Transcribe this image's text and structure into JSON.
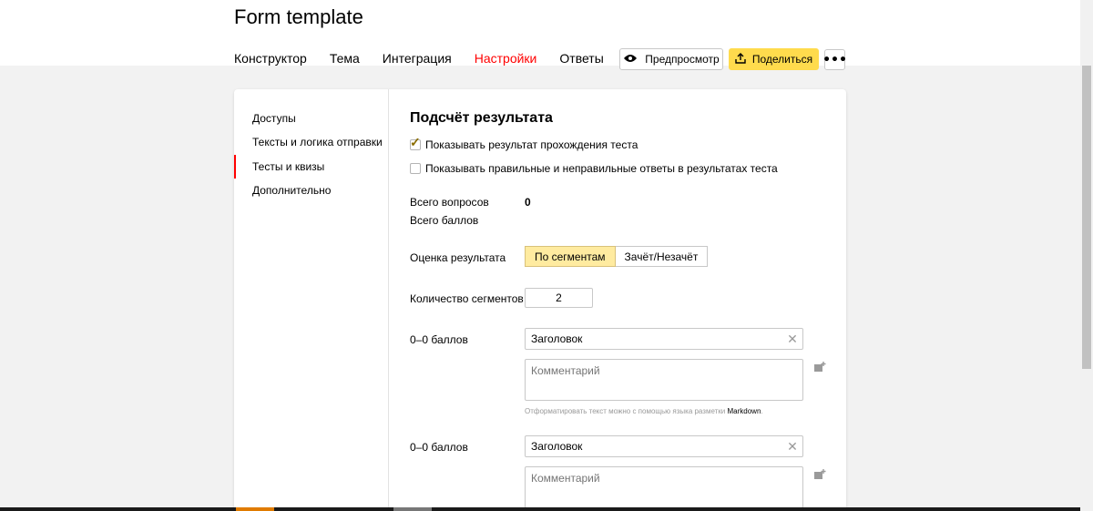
{
  "header": {
    "form_title": "Form template",
    "tabs": [
      {
        "label": "Конструктор",
        "active": false
      },
      {
        "label": "Тема",
        "active": false
      },
      {
        "label": "Интеграция",
        "active": false
      },
      {
        "label": "Настройки",
        "active": true
      },
      {
        "label": "Ответы",
        "active": false
      }
    ],
    "preview_label": "Предпросмотр",
    "share_label": "Поделиться",
    "more_label": "•••"
  },
  "sidebar": {
    "items": [
      {
        "label": "Доступы",
        "active": false
      },
      {
        "label": "Тексты и логика отправки",
        "active": false
      },
      {
        "label": "Тесты и квизы",
        "active": true
      },
      {
        "label": "Дополнительно",
        "active": false
      }
    ]
  },
  "main": {
    "section_title": "Подсчёт результата",
    "checkbox_show_result": {
      "label": "Показывать результат прохождения теста",
      "checked": true
    },
    "checkbox_show_answers": {
      "label": "Показывать правильные и неправильные ответы в результатах теста",
      "checked": false
    },
    "total_questions_label": "Всего вопросов",
    "total_questions_value": "0",
    "total_points_label": "Всего баллов",
    "evaluation_label": "Оценка результата",
    "evaluation_options": [
      {
        "label": "По сегментам",
        "selected": true
      },
      {
        "label": "Зачёт/Незачёт",
        "selected": false
      }
    ],
    "segments_count_label": "Количество сегментов",
    "segments_count_value": "2",
    "segments": [
      {
        "range_label": "0–0 баллов",
        "title_value": "Заголовок",
        "comment_placeholder": "Комментарий"
      },
      {
        "range_label": "0–0 баллов",
        "title_value": "Заголовок",
        "comment_placeholder": "Комментарий"
      }
    ],
    "markdown_hint": "Отформатировать текст можно с помощью языка разметки ",
    "markdown_link": "Markdown",
    "markdown_hint_end": "."
  },
  "colors": {
    "accent_yellow": "#ffdb4d",
    "active_red": "#ff0000",
    "selected_segment_bg": "#ffeba0"
  }
}
